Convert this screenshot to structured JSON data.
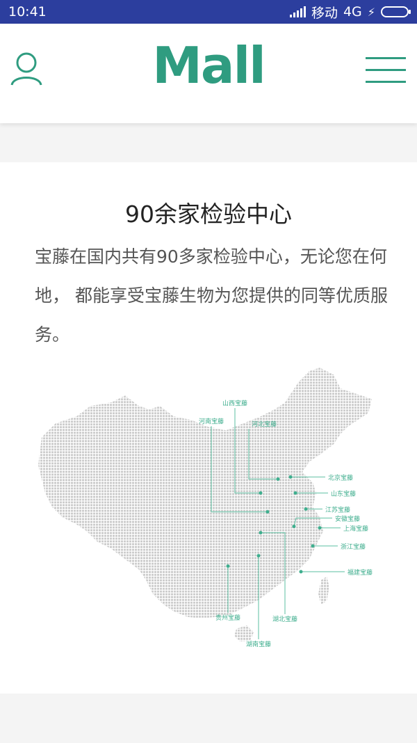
{
  "status_bar": {
    "time": "10:41",
    "carrier": "移动",
    "network": "4G"
  },
  "header": {
    "logo_text": "Mall"
  },
  "section": {
    "title": "90余家检验中心",
    "description": "宝藤在国内共有90多家检验中心，无论您在何地， 都能享受宝藤生物为您提供的同等优质服务。"
  },
  "map": {
    "labels": [
      "山西宝藤",
      "河南宝藤",
      "河北宝藤",
      "北京宝藤",
      "山东宝藤",
      "江苏宝藤",
      "安徽宝藤",
      "上海宝藤",
      "浙江宝藤",
      "福建宝藤",
      "贵州宝藤",
      "湖北宝藤",
      "湖南宝藤"
    ]
  },
  "colors": {
    "accent": "#2f9c80",
    "status_bar": "#2c3e9e",
    "map_dots": "#cfcfcf"
  }
}
